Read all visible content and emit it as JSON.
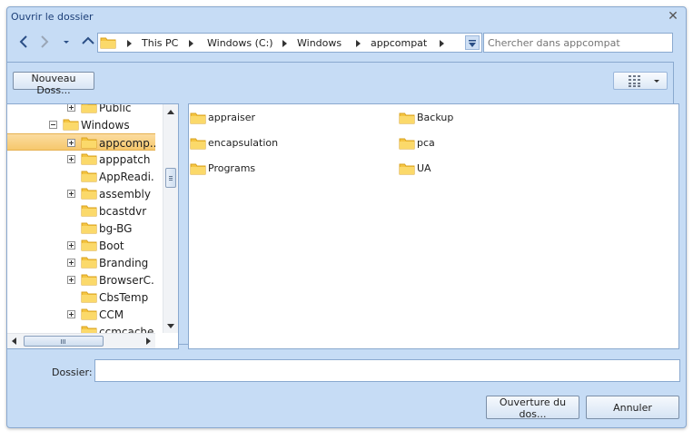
{
  "window": {
    "title": "Ouvrir le dossier",
    "close_glyph": "✕"
  },
  "navigation": {
    "back_icon": "back-arrow-icon",
    "forward_icon": "forward-arrow-icon",
    "recent_icon": "dropdown-small-icon",
    "up_icon": "up-arrow-icon"
  },
  "address_bar": {
    "icon": "folder-icon",
    "crumbs": [
      "This PC",
      "Windows (C:)",
      "Windows",
      "appcompat"
    ]
  },
  "search": {
    "placeholder": "Chercher dans appcompat"
  },
  "toolbar": {
    "new_folder_label": "Nouveau Doss...",
    "view_icon": "view-grid-icon"
  },
  "tree": {
    "items": [
      {
        "label": "Public",
        "level": 2,
        "expander": "plus"
      },
      {
        "label": "Windows",
        "level": 1,
        "expander": "minus"
      },
      {
        "label": "appcomp...",
        "level": 2,
        "expander": "plus",
        "selected": true
      },
      {
        "label": "apppatch",
        "level": 2,
        "expander": "plus"
      },
      {
        "label": "AppReadi...",
        "level": 2,
        "expander": "none"
      },
      {
        "label": "assembly",
        "level": 2,
        "expander": "plus"
      },
      {
        "label": "bcastdvr",
        "level": 2,
        "expander": "none"
      },
      {
        "label": "bg-BG",
        "level": 2,
        "expander": "none"
      },
      {
        "label": "Boot",
        "level": 2,
        "expander": "plus"
      },
      {
        "label": "Branding",
        "level": 2,
        "expander": "plus"
      },
      {
        "label": "BrowserC...",
        "level": 2,
        "expander": "plus"
      },
      {
        "label": "CbsTemp",
        "level": 2,
        "expander": "none"
      },
      {
        "label": "CCM",
        "level": 2,
        "expander": "plus"
      },
      {
        "label": "ccmcache",
        "level": 2,
        "expander": "none"
      }
    ]
  },
  "files": {
    "items": [
      {
        "label": "appraiser"
      },
      {
        "label": "Backup"
      },
      {
        "label": "encapsulation"
      },
      {
        "label": "pca"
      },
      {
        "label": "Programs"
      },
      {
        "label": "UA"
      }
    ]
  },
  "footer": {
    "folder_label": "Dossier:",
    "folder_value": "",
    "open_label": "Ouverture du dos...",
    "cancel_label": "Annuler"
  },
  "colors": {
    "dialog_bg": "#c6dcf5",
    "border": "#8aa9cf",
    "selection": "#f6c86c",
    "folder": "#f5c542"
  }
}
